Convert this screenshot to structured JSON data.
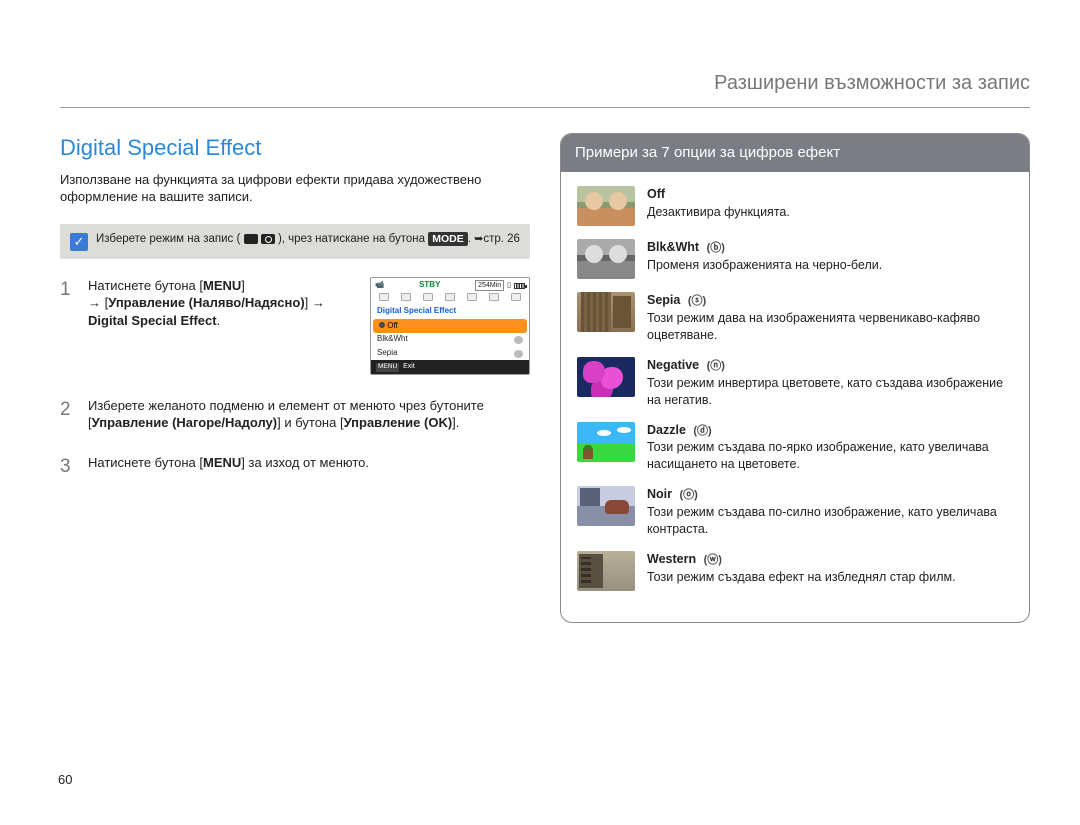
{
  "header": "Разширени възможности за запис",
  "page_number": "60",
  "left": {
    "title": "Digital Special Effect",
    "intro": "Използване на функцията за цифрови ефекти придава художествено оформление на вашите записи.",
    "note_prefix": "Изберете режим на запис (",
    "note_suffix": "), чрез натискане на бутона",
    "note_mode": "MODE",
    "note_page": "стр. 26",
    "step1_a": "Натиснете бутона [",
    "step1_menu": "MENU",
    "step1_b": "]",
    "step1_arrow": "→ [",
    "step1_nav": "Управление (Наляво/Надясно)",
    "step1_c": "] →",
    "step1_dse": "Digital Special Effect",
    "step1_end": ".",
    "step2_a": "Изберете желаното подменю и елемент от менюто чрез бутоните [",
    "step2_nav": "Управление (Нагоре/Надолу)",
    "step2_b": "] и бутона [",
    "step2_ok": "Управление (OK)",
    "step2_c": "].",
    "step3_a": "Натиснете бутона [",
    "step3_menu": "MENU",
    "step3_b": "] за изход от менюто.",
    "lcd": {
      "stby": "STBY",
      "time": "254Min",
      "menu_title": "Digital Special Effect",
      "items": [
        {
          "label": "Off",
          "selected": true
        },
        {
          "label": "Blk&Wht",
          "selected": false
        },
        {
          "label": "Sepia",
          "selected": false
        }
      ],
      "exit_key": "MENU",
      "exit": "Exit"
    }
  },
  "right": {
    "panel_title": "Примери за 7 опции за цифров ефект",
    "effects": [
      {
        "name": "Off",
        "glyph": "",
        "desc": "Дезактивира функцията.",
        "thumb": "thumb-off"
      },
      {
        "name": "Blk&Wht",
        "glyph": "(ⓑ)",
        "desc": "Променя изображенията на черно-бели.",
        "thumb": "thumb-bw"
      },
      {
        "name": "Sepia",
        "glyph": "(ⓢ)",
        "desc": "Този режим дава на изображенията червеникаво-кафяво оцветяване.",
        "thumb": "thumb-sepia"
      },
      {
        "name": "Negative",
        "glyph": "(ⓝ)",
        "desc": "Този режим инвертира цветовете, като създава изображение на негатив.",
        "thumb": "thumb-neg"
      },
      {
        "name": "Dazzle",
        "glyph": "(ⓓ)",
        "desc": "Този режим създава по-ярко изображение, като увеличава насищането на цветовете.",
        "thumb": "thumb-dazzle"
      },
      {
        "name": "Noir",
        "glyph": "(ⓞ)",
        "desc": "Този режим създава по-силно изображение, като увеличава контраста.",
        "thumb": "thumb-noir"
      },
      {
        "name": "Western",
        "glyph": "(ⓦ)",
        "desc": "Този режим създава ефект на избледнял стар филм.",
        "thumb": "thumb-western"
      }
    ]
  }
}
